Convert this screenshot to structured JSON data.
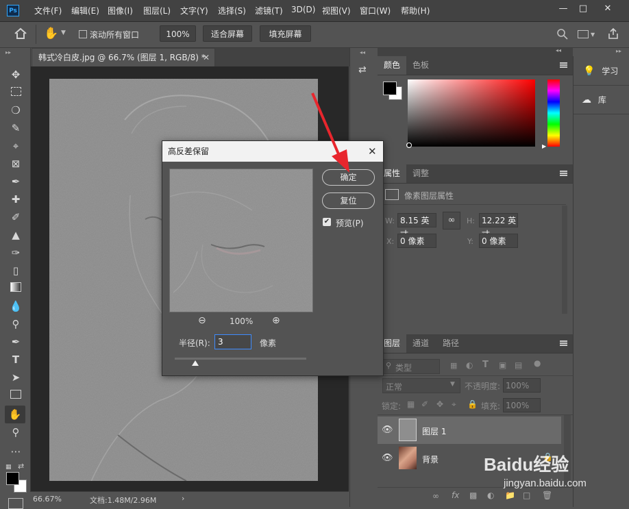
{
  "app": {
    "logo": "Ps"
  },
  "menu": [
    "文件(F)",
    "编辑(E)",
    "图像(I)",
    "图层(L)",
    "文字(Y)",
    "选择(S)",
    "滤镜(T)",
    "3D(D)",
    "视图(V)",
    "窗口(W)",
    "帮助(H)"
  ],
  "options": {
    "scroll_all": "滚动所有窗口",
    "zoom_value": "100%",
    "fit_screen": "适合屏幕",
    "fill_screen": "填充屏幕"
  },
  "document": {
    "tab_title": "韩式冷白皮.jpg @ 66.7% (图层 1, RGB/8) *",
    "zoom": "66.67%",
    "doc_info": "文档:1.48M/2.96M"
  },
  "color_panel": {
    "tabs": [
      "颜色",
      "色板"
    ],
    "active_tab": "颜色",
    "accent": "#ff0000"
  },
  "properties_panel": {
    "tabs": [
      "属性",
      "调整"
    ],
    "subtitle": "像素图层属性",
    "w_label": "W:",
    "w_value": "8.15 英寸",
    "h_label": "H:",
    "h_value": "12.22 英寸",
    "x_label": "X:",
    "x_value": "0 像素",
    "y_label": "Y:",
    "y_value": "0 像素"
  },
  "layers_panel": {
    "tabs": [
      "图层",
      "通道",
      "路径"
    ],
    "filter_kind": "类型",
    "blend_mode": "正常",
    "opacity_label": "不透明度:",
    "opacity_value": "100%",
    "lock_label": "锁定:",
    "fill_label": "填充:",
    "fill_value": "100%",
    "layers": [
      {
        "name": "图层 1",
        "selected": true
      },
      {
        "name": "背景",
        "selected": false
      }
    ]
  },
  "right_panel": {
    "learn": "学习",
    "library": "库"
  },
  "dialog": {
    "title": "高反差保留",
    "ok": "确定",
    "reset": "复位",
    "preview_label": "预览(P)",
    "preview_checked": true,
    "zoom": "100%",
    "radius_label": "半径(R):",
    "radius_value": "3",
    "radius_unit": "像素"
  },
  "watermark": {
    "brand": "Baidu经验",
    "url": "jingyan.baidu.com"
  },
  "colors": {
    "arrow": "#e8262d",
    "selection_bg": "#6a6a6a"
  }
}
